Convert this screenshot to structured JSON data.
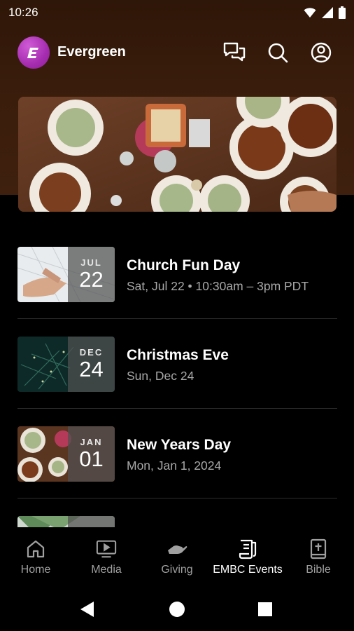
{
  "status": {
    "time": "10:26"
  },
  "app": {
    "title": "Evergreen",
    "logo_letter": "E",
    "brand_color": "#a52cb0"
  },
  "header_icons": [
    "chat-icon",
    "search-icon",
    "account-icon"
  ],
  "events": [
    {
      "month": "JUL",
      "day": "22",
      "title": "Church Fun Day",
      "subtitle": "Sat, Jul 22 • 10:30am – 3pm PDT"
    },
    {
      "month": "DEC",
      "day": "24",
      "title": "Christmas Eve",
      "subtitle": "Sun, Dec 24"
    },
    {
      "month": "JAN",
      "day": "01",
      "title": "New Years Day",
      "subtitle": "Mon, Jan 1, 2024"
    }
  ],
  "nav": [
    {
      "label": "Home",
      "icon": "home-icon",
      "active": false
    },
    {
      "label": "Media",
      "icon": "media-icon",
      "active": false
    },
    {
      "label": "Giving",
      "icon": "giving-icon",
      "active": false
    },
    {
      "label": "EMBC Events",
      "icon": "events-icon",
      "active": true
    },
    {
      "label": "Bible",
      "icon": "bible-icon",
      "active": false
    }
  ],
  "system_nav": [
    "back-icon",
    "home-circle-icon",
    "recents-icon"
  ]
}
